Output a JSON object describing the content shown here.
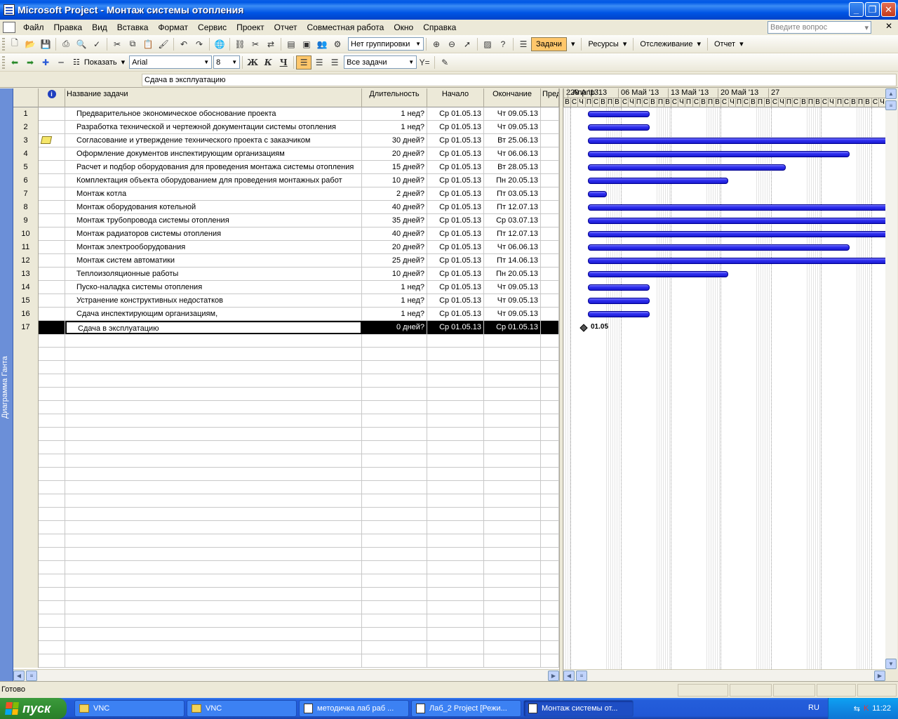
{
  "window": {
    "title": "Microsoft Project - Монтаж системы отопления"
  },
  "menu": {
    "items": [
      "Файл",
      "Правка",
      "Вид",
      "Вставка",
      "Формат",
      "Сервис",
      "Проект",
      "Отчет",
      "Совместная работа",
      "Окно",
      "Справка"
    ],
    "question_placeholder": "Введите вопрос"
  },
  "toolbar1": {
    "grouping": "Нет группировки",
    "guide_tabs": [
      "Задачи",
      "Ресурсы",
      "Отслеживание",
      "Отчет"
    ],
    "active_tab": "Задачи"
  },
  "toolbar2": {
    "show_label": "Показать",
    "font": "Arial",
    "font_size": "8",
    "bold": "Ж",
    "italic": "К",
    "underline": "Ч",
    "filter": "Все задачи"
  },
  "entry_bar": {
    "value": "Сдача в эксплуатацию"
  },
  "view_bar": {
    "label": "Диаграмма Ганта"
  },
  "table": {
    "columns": {
      "indicators": "i",
      "name": "Название задачи",
      "duration": "Длительность",
      "start": "Начало",
      "finish": "Окончание",
      "pred": "Пред"
    },
    "rows": [
      {
        "id": "1",
        "name": "Предварительное экономическое обоснование проекта",
        "duration": "1 нед?",
        "start": "Ср 01.05.13",
        "finish": "Чт 09.05.13"
      },
      {
        "id": "2",
        "name": "Разработка технической и чертежной документации системы отопления",
        "duration": "1 нед?",
        "start": "Ср 01.05.13",
        "finish": "Чт 09.05.13"
      },
      {
        "id": "3",
        "name": "Согласование и утверждение технического проекта с заказчиком",
        "duration": "30 дней?",
        "start": "Ср 01.05.13",
        "finish": "Вт 25.06.13",
        "note": true
      },
      {
        "id": "4",
        "name": "Оформление документов инспектирующим организациям",
        "duration": "20 дней?",
        "start": "Ср 01.05.13",
        "finish": "Чт 06.06.13"
      },
      {
        "id": "5",
        "name": "Расчет и подбор оборудования для проведения монтажа системы отопления",
        "duration": "15 дней?",
        "start": "Ср 01.05.13",
        "finish": "Вт 28.05.13"
      },
      {
        "id": "6",
        "name": " Комплектация объекта оборудованием для проведения монтажных работ",
        "duration": "10 дней?",
        "start": "Ср 01.05.13",
        "finish": "Пн 20.05.13"
      },
      {
        "id": "7",
        "name": "Монтаж котла",
        "duration": "2 дней?",
        "start": "Ср 01.05.13",
        "finish": "Пт 03.05.13"
      },
      {
        "id": "8",
        "name": "Монтаж оборудования котельной",
        "duration": "40 дней?",
        "start": "Ср 01.05.13",
        "finish": "Пт 12.07.13"
      },
      {
        "id": "9",
        "name": "Монтаж трубопровода системы отопления",
        "duration": "35 дней?",
        "start": "Ср 01.05.13",
        "finish": "Ср 03.07.13"
      },
      {
        "id": "10",
        "name": "Монтаж радиаторов системы отопления",
        "duration": "40 дней?",
        "start": "Ср 01.05.13",
        "finish": "Пт 12.07.13"
      },
      {
        "id": "11",
        "name": "Монтаж электрооборудования",
        "duration": "20 дней?",
        "start": "Ср 01.05.13",
        "finish": "Чт 06.06.13"
      },
      {
        "id": "12",
        "name": "Монтаж систем автоматики",
        "duration": "25 дней?",
        "start": "Ср 01.05.13",
        "finish": "Пт 14.06.13"
      },
      {
        "id": "13",
        "name": "Теплоизоляционные работы",
        "duration": "10 дней?",
        "start": "Ср 01.05.13",
        "finish": "Пн 20.05.13"
      },
      {
        "id": "14",
        "name": "Пуско-наладка системы отопления",
        "duration": "1 нед?",
        "start": "Ср 01.05.13",
        "finish": "Чт 09.05.13"
      },
      {
        "id": "15",
        "name": " Устранение конструктивных недостатков",
        "duration": "1 нед?",
        "start": "Ср 01.05.13",
        "finish": "Чт 09.05.13"
      },
      {
        "id": "16",
        "name": "Сдача инспектирующим организациям,",
        "duration": "1 нед?",
        "start": "Ср 01.05.13",
        "finish": "Чт 09.05.13"
      },
      {
        "id": "17",
        "name": "Сдача в эксплуатацию",
        "duration": "0 дней?",
        "start": "Ср 01.05.13",
        "finish": "Ср 01.05.13",
        "selected": true
      }
    ]
  },
  "gantt": {
    "weeks": [
      "2 Апр '13",
      "29 Апр '13",
      "06 Май '13",
      "13 Май '13",
      "20 Май '13",
      "27"
    ],
    "day_letters": [
      "В",
      "С",
      "Ч",
      "П",
      "С",
      "В",
      "П",
      "В",
      "С",
      "Ч",
      "П",
      "С",
      "В",
      "П",
      "В",
      "С",
      "Ч",
      "П",
      "С",
      "В",
      "П",
      "В",
      "С",
      "Ч",
      "П",
      "С",
      "В",
      "П",
      "В",
      "С",
      "Ч",
      "П",
      "С",
      "В",
      "П",
      "В",
      "С",
      "Ч",
      "П",
      "С",
      "В",
      "П",
      "В",
      "С",
      "Ч"
    ],
    "milestone_label": "01.05"
  },
  "status": {
    "text": "Готово"
  },
  "taskbar": {
    "start_label": "пуск",
    "buttons": [
      "VNC",
      "VNC",
      "методичка лаб раб ...",
      "Лаб_2 Project [Режи...",
      "Монтаж системы от..."
    ],
    "active_index": 4,
    "lang": "RU",
    "clock": "11:22"
  }
}
